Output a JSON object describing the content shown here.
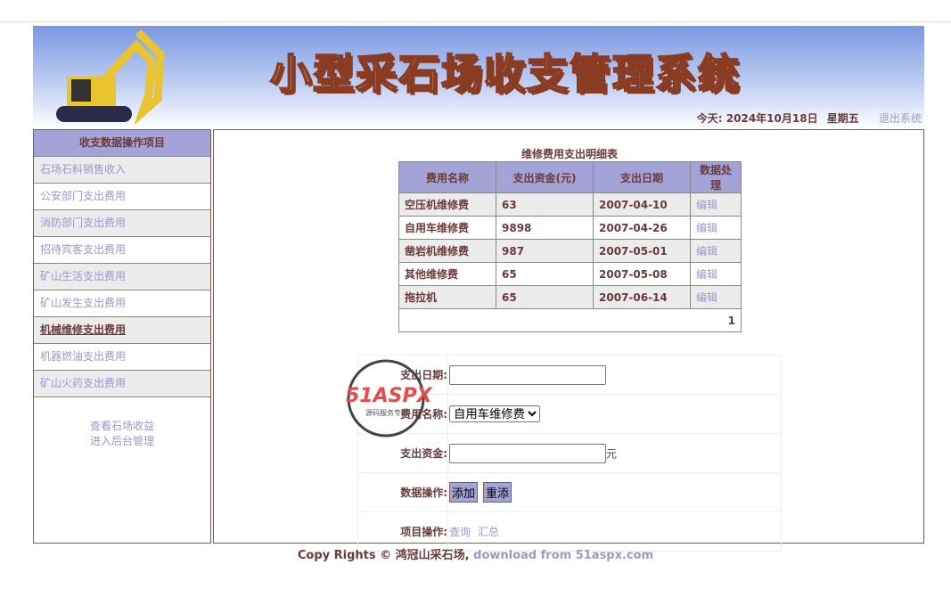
{
  "header": {
    "title": "小型采石场收支管理系统",
    "today_label": "今天:",
    "date": "2024年10月18日",
    "weekday": "星期五",
    "logout": "退出系统"
  },
  "sidebar": {
    "heading": "收支数据操作项目",
    "items": [
      "石场石料销售收入",
      "公安部门支出费用",
      "消防部门支出费用",
      "招待宾客支出费用",
      "矿山生活支出费用",
      "矿山发生支出费用",
      "机械维修支出费用",
      "机器燃油支出费用",
      "矿山火药支出费用"
    ],
    "active_index": 6,
    "links": [
      "查看石场收益",
      "进入后台管理"
    ]
  },
  "table": {
    "caption": "维修费用支出明细表",
    "headers": [
      "费用名称",
      "支出资金(元)",
      "支出日期",
      "数据处理"
    ],
    "rows": [
      [
        "空压机维修费",
        "63",
        "2007-04-10",
        "编辑"
      ],
      [
        "自用车维修费",
        "9898",
        "2007-04-26",
        "编辑"
      ],
      [
        "凿岩机维修费",
        "987",
        "2007-05-01",
        "编辑"
      ],
      [
        "其他维修费",
        "65",
        "2007-05-08",
        "编辑"
      ],
      [
        "拖拉机",
        "65",
        "2007-06-14",
        "编辑"
      ]
    ],
    "page": "1"
  },
  "form": {
    "date_label": "支出日期:",
    "date_value": "",
    "name_label": "费用名称:",
    "name_value": "自用车维修费",
    "amount_label": "支出资金:",
    "amount_value": "",
    "unit": "元",
    "ops_label": "数据操作:",
    "add": "添加",
    "reset": "重添",
    "proj_label": "项目操作:",
    "query": "查询",
    "summary": "汇总"
  },
  "watermark": {
    "brand": "51ASPX",
    "sub": "源码服务专家"
  },
  "footer": {
    "text": "Copy Rights © 鸿冠山采石场,",
    "link": "download from 51aspx.com"
  }
}
